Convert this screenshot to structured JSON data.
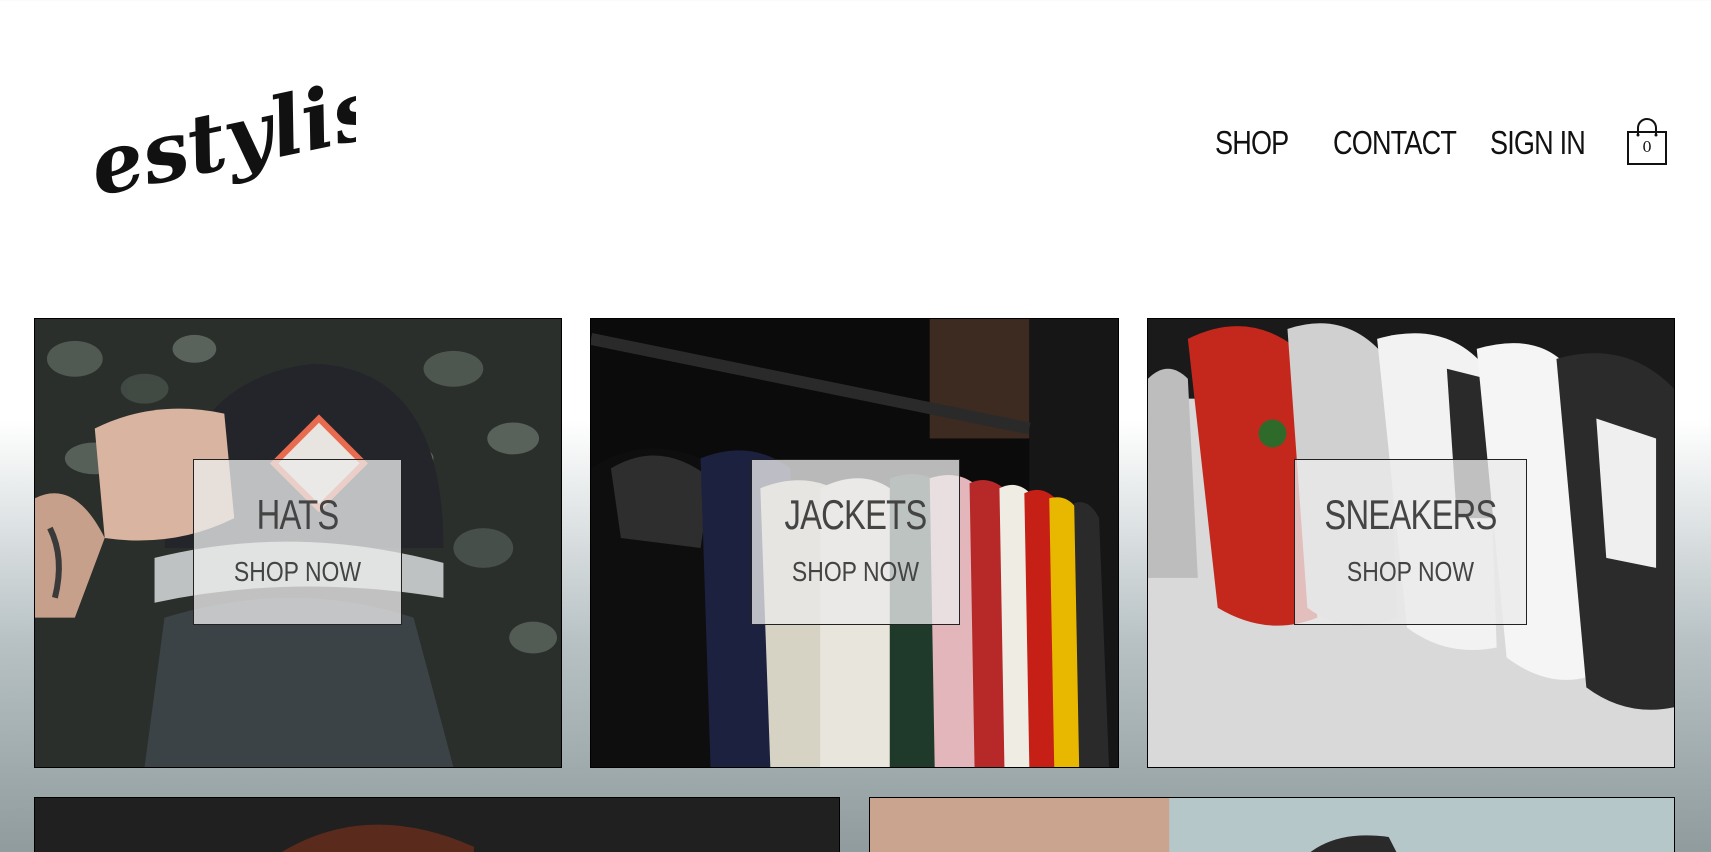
{
  "brand": {
    "logo_text": "estylish"
  },
  "nav": {
    "items": [
      {
        "label": "SHOP"
      },
      {
        "label": "CONTACT"
      },
      {
        "label": "SIGN IN"
      }
    ],
    "cart": {
      "icon": "shopping-bag-icon",
      "count": "0"
    }
  },
  "categories": [
    {
      "title": "HATS",
      "cta": "SHOP NOW"
    },
    {
      "title": "JACKETS",
      "cta": "SHOP NOW"
    },
    {
      "title": "SNEAKERS",
      "cta": "SHOP NOW"
    }
  ],
  "colors": {
    "text": "#111111",
    "overlay_text": "#444444",
    "border": "#000000",
    "sneaker_red": "#c4281c",
    "jacket_yellow": "#e8b800"
  }
}
